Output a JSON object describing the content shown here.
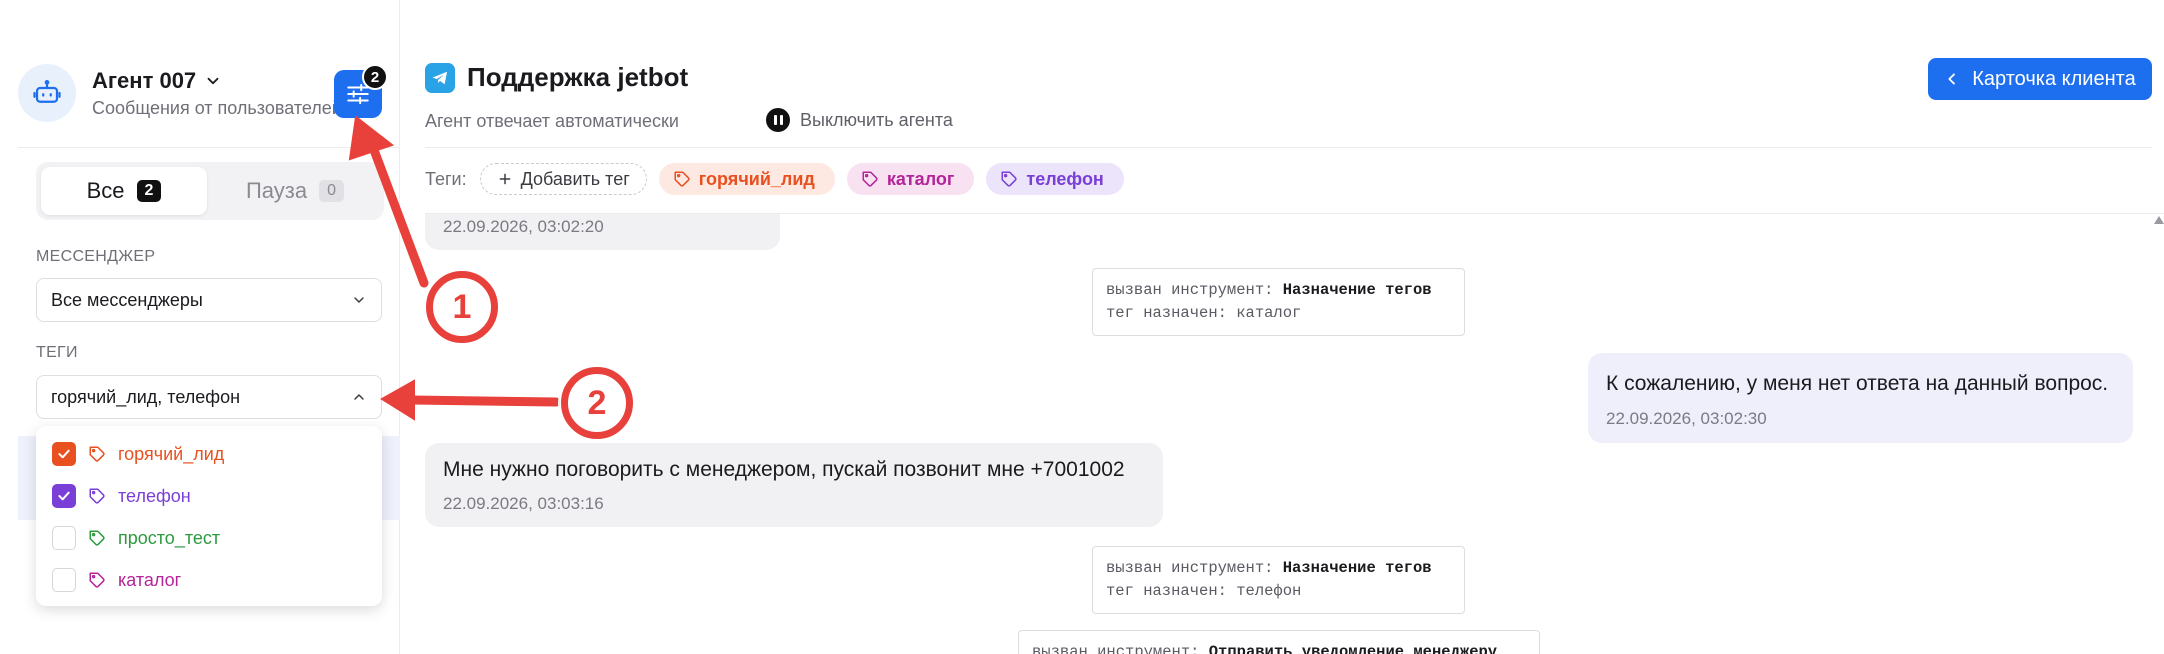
{
  "sidebar": {
    "agent_name": "Агент 007",
    "agent_subtitle": "Сообщения от пользователей",
    "filter_badge": "2",
    "segments": {
      "all_label": "Все",
      "all_count": "2",
      "pause_label": "Пауза",
      "pause_count": "0"
    },
    "messenger_label": "МЕССЕНДЖЕР",
    "messenger_value": "Все мессенджеры",
    "tags_label": "ТЕГИ",
    "tags_value": "горячий_лид, телефон",
    "tag_options": [
      {
        "label": "горячий_лид",
        "checked": true,
        "color": "#e8501f"
      },
      {
        "label": "телефон",
        "checked": true,
        "color": "#7a3fd6"
      },
      {
        "label": "просто_тест",
        "checked": false,
        "color": "#2d9a3f"
      },
      {
        "label": "каталог",
        "checked": false,
        "color": "#b3259a"
      }
    ]
  },
  "header": {
    "chat_title": "Поддержка jetbot",
    "agent_status": "Агент отвечает автоматически",
    "disable_agent_label": "Выключить агента",
    "client_card_label": "Карточка клиента"
  },
  "tags_bar": {
    "label": "Теги:",
    "add_tag_label": "Добавить тег",
    "tags": [
      {
        "label": "горячий_лид",
        "color": "#e8501f",
        "bg": "#fde8e2"
      },
      {
        "label": "каталог",
        "color": "#b3259a",
        "bg": "#f8e1f1"
      },
      {
        "label": "телефон",
        "color": "#7a3fd6",
        "bg": "#ece4fb"
      }
    ]
  },
  "messages": {
    "m0_time": "22.09.2026, 03:02:20",
    "tool1": {
      "prefix": "вызван инструмент:",
      "name": "Назначение тегов",
      "line2": "тег назначен: каталог"
    },
    "m1_text": "К сожалению, у меня нет ответа на данный вопрос.",
    "m1_time": "22.09.2026, 03:02:30",
    "m2_text": "Мне  нужно поговорить с менеджером, пускай позвонит мне +7001002",
    "m2_time": "22.09.2026, 03:03:16",
    "tool2": {
      "prefix": "вызван инструмент:",
      "name": "Назначение тегов",
      "line2": "тег назначен: телефон"
    },
    "tool3": {
      "prefix": "вызван инструмент:",
      "name": "Отправить уведомление менеджеру"
    }
  },
  "annotations": {
    "callout_1": "1",
    "callout_2": "2",
    "accent_color": "#e8403a"
  },
  "colors": {
    "primary": "#1e6ef0",
    "telegram": "#2aa3e6"
  }
}
